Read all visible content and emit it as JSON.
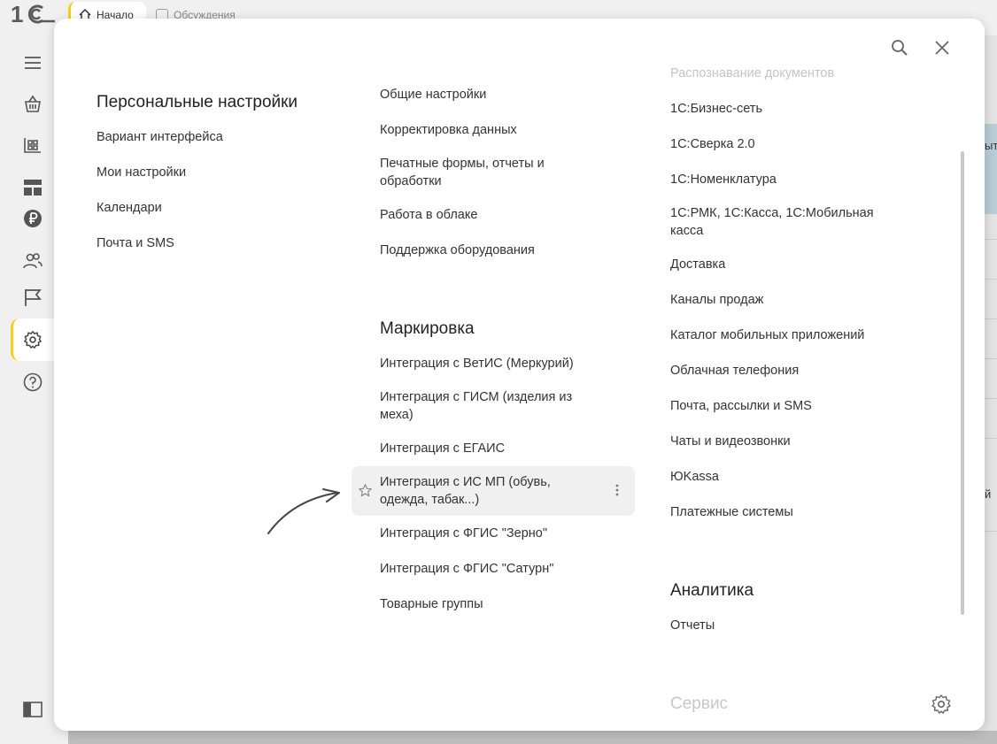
{
  "topbar": {
    "logo_icon": "1c-logo-icon",
    "tabs": [
      {
        "label": "Начало",
        "icon": "home-icon"
      },
      {
        "label": "Обсуждения",
        "icon": "checkbox-icon"
      }
    ]
  },
  "sidebar": {
    "icons": [
      "menu-icon",
      "basket-icon",
      "warehouse-icon",
      "dashboard-icon",
      "ruble-icon",
      "users-icon",
      "flag-icon",
      "gear-icon",
      "help-icon",
      "panel-toggle-icon"
    ],
    "active": "gear-icon",
    "accent_color": "#f2d11c"
  },
  "background_app": {
    "text_fragments": [
      "ыт",
      "й"
    ]
  },
  "modal": {
    "tools": [
      "search-icon",
      "close-icon"
    ],
    "columns": [
      {
        "sections": [
          {
            "heading": "Персональные настройки",
            "items": [
              "Вариант интерфейса",
              "Мои настройки",
              "Календари",
              "Почта и SMS"
            ]
          }
        ]
      },
      {
        "sections": [
          {
            "heading": "",
            "items": [
              "Общие настройки",
              "Корректировка данных",
              "Печатные формы, отчеты и обработки",
              "Работа в облаке",
              "Поддержка оборудования"
            ]
          },
          {
            "heading": "Маркировка",
            "items": [
              "Интеграция с ВетИС (Меркурий)",
              "Интеграция с ГИСМ (изделия из меха)",
              "Интеграция с ЕГАИС",
              "Интеграция с ИС МП (обувь, одежда, табак...)",
              "Интеграция с ФГИС \"Зерно\"",
              "Интеграция с ФГИС \"Сатурн\"",
              "Товарные группы"
            ]
          }
        ]
      },
      {
        "sections": [
          {
            "heading": "",
            "items": [
              "Распознавание документов",
              "1С:Бизнес-сеть",
              "1С:Сверка 2.0",
              "1С:Номенклатура",
              "1С:РМК, 1С:Касса, 1С:Мобильная касса",
              "Доставка",
              "Каналы продаж",
              "Каталог мобильных приложений",
              "Облачная телефония",
              "Почта, рассылки и SMS",
              "Чаты и видеозвонки",
              "ЮKassa",
              "Платежные системы"
            ]
          },
          {
            "heading": "Аналитика",
            "items": [
              "Отчеты"
            ]
          },
          {
            "heading": "Сервис",
            "items": []
          }
        ]
      }
    ],
    "hovered_item": "Интеграция с ИС МП (обувь, одежда, табак...)",
    "hover_icons": [
      "star-icon",
      "more-vertical-icon"
    ],
    "annotation": "arrow-pointer-icon",
    "footer_icon": "settings-gear-icon"
  }
}
